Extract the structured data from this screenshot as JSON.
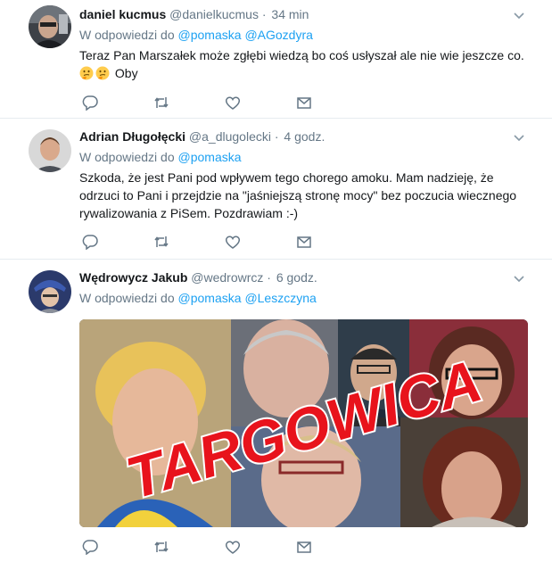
{
  "tweets": [
    {
      "fullname": "daniel kucmus",
      "username": "@danielkucmus",
      "separator": "·",
      "time": "34 min",
      "reply_prefix": "W odpowiedzi do",
      "mentions": [
        "@pomaska",
        "@AGozdyra"
      ],
      "text": "Teraz Pan Marszałek może zgłębi wiedzą bo coś usłyszał ale nie wie jeszcze co.",
      "text_after_emoji": "Oby",
      "emoji": [
        "thinking-face",
        "thinking-face"
      ]
    },
    {
      "fullname": "Adrian Długołęcki",
      "username": "@a_dlugolecki",
      "separator": "·",
      "time": "4 godz.",
      "reply_prefix": "W odpowiedzi do",
      "mentions": [
        "@pomaska"
      ],
      "text": "Szkoda, że jest Pani pod wpływem tego chorego amoku. Mam nadzieję, że odrzuci to Pani i przejdzie na \"jaśniejszą stronę mocy\" bez poczucia wiecznego rywalizowania z PiSem. Pozdrawiam :-)"
    },
    {
      "fullname": "Wędrowycz Jakub",
      "username": "@wedrowrcz",
      "separator": "·",
      "time": "6 godz.",
      "reply_prefix": "W odpowiedzi do",
      "mentions": [
        "@pomaska",
        "@Leszczyna"
      ],
      "media_caption": "TARGOWICA"
    }
  ],
  "icons": {
    "reply": "reply-icon",
    "retweet": "retweet-icon",
    "like": "heart-icon",
    "dm": "envelope-icon",
    "menu": "chevron-down-icon"
  },
  "colors": {
    "link": "#1da1f2",
    "secondary": "#657786",
    "text": "#14171a",
    "divider": "#e6ecf0",
    "caption_red": "#e8131c"
  }
}
